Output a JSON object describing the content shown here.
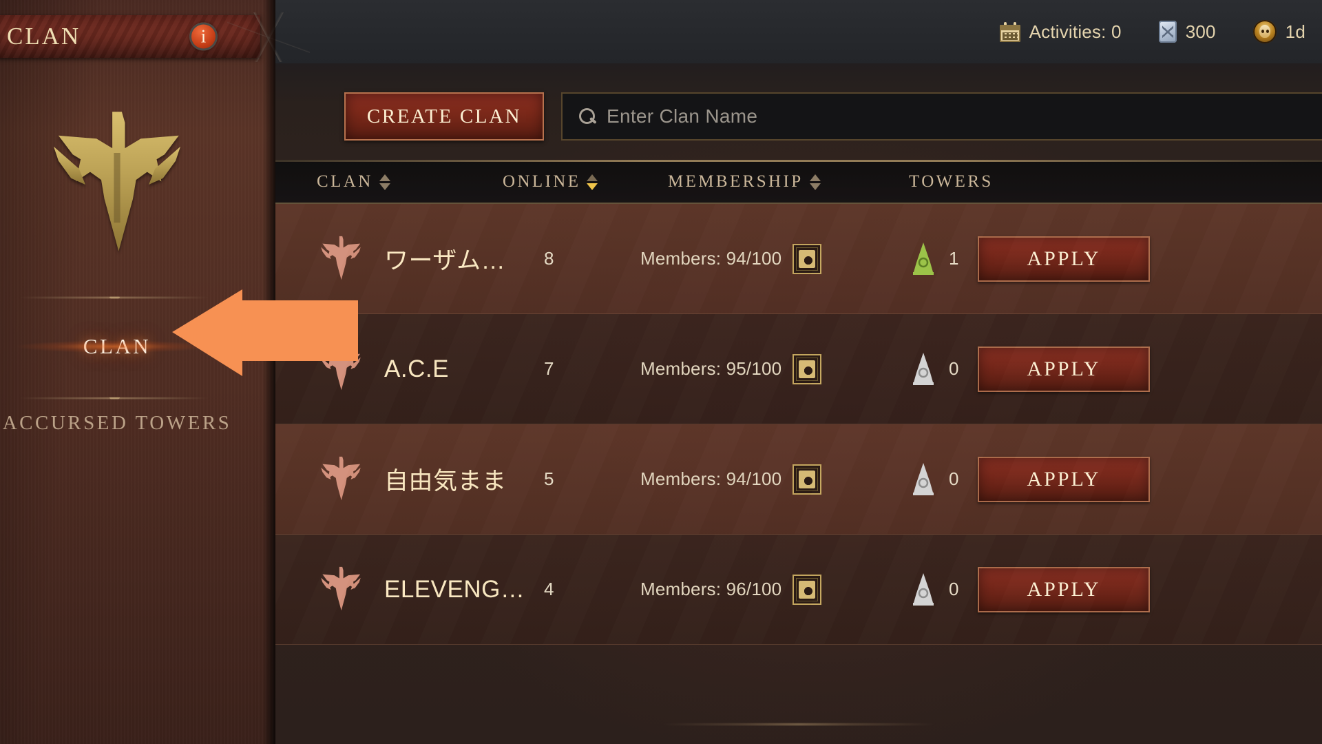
{
  "window": {
    "progress_strip": {
      "fill_color": "#e2751f",
      "track_color": "#d9d9d9"
    }
  },
  "statusbar": {
    "items": [
      {
        "icon": "calendar-icon",
        "label": "Activities: 0"
      },
      {
        "icon": "rune-scroll-icon",
        "label": "300"
      },
      {
        "icon": "boss-head-icon",
        "label": "1d"
      }
    ]
  },
  "sidebar": {
    "title": "CLAN",
    "info_badge": "i",
    "emblem_icon": "clan-crest-icon",
    "nav": [
      {
        "label": "CLAN",
        "active": true
      },
      {
        "label": "ACCURSED TOWERS",
        "active": false
      }
    ]
  },
  "annotation": {
    "arrow_color": "#F79153",
    "points_to": "CLAN"
  },
  "toolbar": {
    "create_clan_label": "CREATE CLAN",
    "search_icon": "search-icon",
    "search_placeholder": "Enter Clan Name",
    "search_value": ""
  },
  "table": {
    "columns": [
      {
        "key": "clan",
        "label": "CLAN",
        "sortable": true,
        "sort": "none"
      },
      {
        "key": "online",
        "label": "ONLINE",
        "sortable": true,
        "sort": "desc"
      },
      {
        "key": "membership",
        "label": "MEMBERSHIP",
        "sortable": true,
        "sort": "none"
      },
      {
        "key": "towers",
        "label": "TOWERS",
        "sortable": false,
        "sort": "none"
      }
    ],
    "rows": [
      {
        "emblem": "clan-crest-icon",
        "name": "ワーザム…",
        "online": "8",
        "membership": "Members: 94/100",
        "membership_icon": "member-detail-icon",
        "tower_icon": "tower-icon-active",
        "tower_color": "#9ec64a",
        "towers": "1",
        "apply_label": "APPLY"
      },
      {
        "emblem": "clan-crest-icon",
        "name": "A.C.E",
        "online": "7",
        "membership": "Members: 95/100",
        "membership_icon": "member-detail-icon",
        "tower_icon": "tower-icon-inactive",
        "tower_color": "#d7d7d7",
        "towers": "0",
        "apply_label": "APPLY"
      },
      {
        "emblem": "clan-crest-icon",
        "name": "自由気まま",
        "online": "5",
        "membership": "Members: 94/100",
        "membership_icon": "member-detail-icon",
        "tower_icon": "tower-icon-inactive",
        "tower_color": "#d7d7d7",
        "towers": "0",
        "apply_label": "APPLY"
      },
      {
        "emblem": "clan-crest-icon",
        "name": "ELEVENG…",
        "online": "4",
        "membership": "Members: 96/100",
        "membership_icon": "member-detail-icon",
        "tower_icon": "tower-icon-inactive",
        "tower_color": "#d7d7d7",
        "towers": "0",
        "apply_label": "APPLY"
      }
    ]
  },
  "colors": {
    "accent_red": "#7a2819",
    "gold_text": "#fbe9c2",
    "panel_brown": "#5a3427",
    "sort_active": "#f0c54a"
  }
}
